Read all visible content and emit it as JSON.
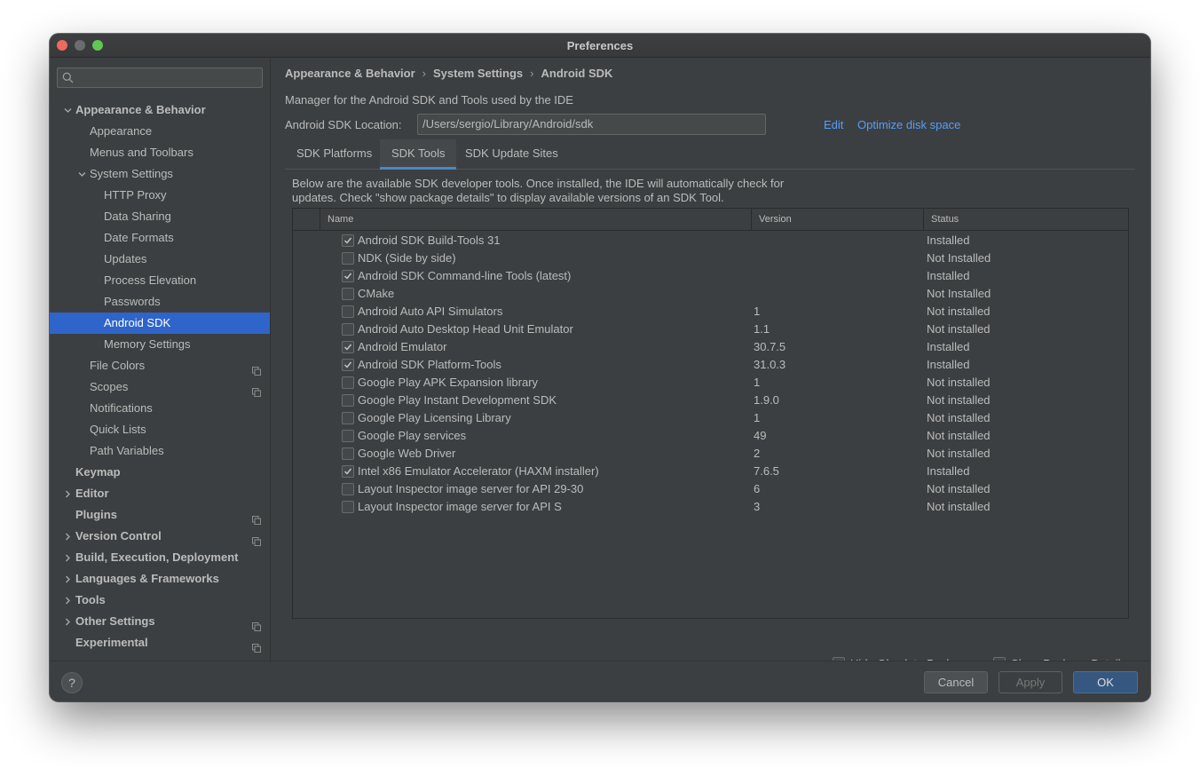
{
  "window": {
    "title": "Preferences"
  },
  "sidebar": {
    "search_placeholder": "",
    "items": [
      {
        "label": "Appearance & Behavior",
        "level": 0,
        "bold": true,
        "arrow": "down",
        "project": false,
        "selected": false
      },
      {
        "label": "Appearance",
        "level": 1,
        "bold": false,
        "arrow": "",
        "project": false,
        "selected": false
      },
      {
        "label": "Menus and Toolbars",
        "level": 1,
        "bold": false,
        "arrow": "",
        "project": false,
        "selected": false
      },
      {
        "label": "System Settings",
        "level": 1,
        "bold": false,
        "arrow": "down",
        "project": false,
        "selected": false
      },
      {
        "label": "HTTP Proxy",
        "level": 2,
        "bold": false,
        "arrow": "",
        "project": false,
        "selected": false
      },
      {
        "label": "Data Sharing",
        "level": 2,
        "bold": false,
        "arrow": "",
        "project": false,
        "selected": false
      },
      {
        "label": "Date Formats",
        "level": 2,
        "bold": false,
        "arrow": "",
        "project": false,
        "selected": false
      },
      {
        "label": "Updates",
        "level": 2,
        "bold": false,
        "arrow": "",
        "project": false,
        "selected": false
      },
      {
        "label": "Process Elevation",
        "level": 2,
        "bold": false,
        "arrow": "",
        "project": false,
        "selected": false
      },
      {
        "label": "Passwords",
        "level": 2,
        "bold": false,
        "arrow": "",
        "project": false,
        "selected": false
      },
      {
        "label": "Android SDK",
        "level": 2,
        "bold": false,
        "arrow": "",
        "project": false,
        "selected": true
      },
      {
        "label": "Memory Settings",
        "level": 2,
        "bold": false,
        "arrow": "",
        "project": false,
        "selected": false
      },
      {
        "label": "File Colors",
        "level": 1,
        "bold": false,
        "arrow": "",
        "project": true,
        "selected": false
      },
      {
        "label": "Scopes",
        "level": 1,
        "bold": false,
        "arrow": "",
        "project": true,
        "selected": false
      },
      {
        "label": "Notifications",
        "level": 1,
        "bold": false,
        "arrow": "",
        "project": false,
        "selected": false
      },
      {
        "label": "Quick Lists",
        "level": 1,
        "bold": false,
        "arrow": "",
        "project": false,
        "selected": false
      },
      {
        "label": "Path Variables",
        "level": 1,
        "bold": false,
        "arrow": "",
        "project": false,
        "selected": false
      },
      {
        "label": "Keymap",
        "level": 0,
        "bold": true,
        "arrow": "",
        "project": false,
        "selected": false
      },
      {
        "label": "Editor",
        "level": 0,
        "bold": true,
        "arrow": "right",
        "project": false,
        "selected": false
      },
      {
        "label": "Plugins",
        "level": 0,
        "bold": true,
        "arrow": "",
        "project": true,
        "selected": false
      },
      {
        "label": "Version Control",
        "level": 0,
        "bold": true,
        "arrow": "right",
        "project": true,
        "selected": false
      },
      {
        "label": "Build, Execution, Deployment",
        "level": 0,
        "bold": true,
        "arrow": "right",
        "project": false,
        "selected": false
      },
      {
        "label": "Languages & Frameworks",
        "level": 0,
        "bold": true,
        "arrow": "right",
        "project": false,
        "selected": false
      },
      {
        "label": "Tools",
        "level": 0,
        "bold": true,
        "arrow": "right",
        "project": false,
        "selected": false
      },
      {
        "label": "Other Settings",
        "level": 0,
        "bold": true,
        "arrow": "right",
        "project": true,
        "selected": false
      },
      {
        "label": "Experimental",
        "level": 0,
        "bold": true,
        "arrow": "",
        "project": true,
        "selected": false
      }
    ]
  },
  "breadcrumb": {
    "part1": "Appearance & Behavior",
    "part2": "System Settings",
    "part3": "Android SDK",
    "separator": "›"
  },
  "main": {
    "description": "Manager for the Android SDK and Tools used by the IDE",
    "location_label": "Android SDK Location:",
    "location_value": "/Users/sergio/Library/Android/sdk",
    "edit_link": "Edit",
    "optimize_link": "Optimize disk space",
    "tabs": [
      {
        "label": "SDK Platforms",
        "active": false
      },
      {
        "label": "SDK Tools",
        "active": true
      },
      {
        "label": "SDK Update Sites",
        "active": false
      }
    ],
    "tools_description_line1": "Below are the available SDK developer tools. Once installed, the IDE will automatically check for",
    "tools_description_line2": "updates. Check \"show package details\" to display available versions of an SDK Tool.",
    "table": {
      "columns": {
        "name": "Name",
        "version": "Version",
        "status": "Status"
      },
      "rows": [
        {
          "name": "Android SDK Build-Tools 31",
          "version": "",
          "status": "Installed",
          "checked": true
        },
        {
          "name": "NDK (Side by side)",
          "version": "",
          "status": "Not Installed",
          "checked": false
        },
        {
          "name": "Android SDK Command-line Tools (latest)",
          "version": "",
          "status": "Installed",
          "checked": true
        },
        {
          "name": "CMake",
          "version": "",
          "status": "Not Installed",
          "checked": false
        },
        {
          "name": "Android Auto API Simulators",
          "version": "1",
          "status": "Not installed",
          "checked": false
        },
        {
          "name": "Android Auto Desktop Head Unit Emulator",
          "version": "1.1",
          "status": "Not installed",
          "checked": false
        },
        {
          "name": "Android Emulator",
          "version": "30.7.5",
          "status": "Installed",
          "checked": true
        },
        {
          "name": "Android SDK Platform-Tools",
          "version": "31.0.3",
          "status": "Installed",
          "checked": true
        },
        {
          "name": "Google Play APK Expansion library",
          "version": "1",
          "status": "Not installed",
          "checked": false
        },
        {
          "name": "Google Play Instant Development SDK",
          "version": "1.9.0",
          "status": "Not installed",
          "checked": false
        },
        {
          "name": "Google Play Licensing Library",
          "version": "1",
          "status": "Not installed",
          "checked": false
        },
        {
          "name": "Google Play services",
          "version": "49",
          "status": "Not installed",
          "checked": false
        },
        {
          "name": "Google Web Driver",
          "version": "2",
          "status": "Not installed",
          "checked": false
        },
        {
          "name": "Intel x86 Emulator Accelerator (HAXM installer)",
          "version": "7.6.5",
          "status": "Installed",
          "checked": true
        },
        {
          "name": "Layout Inspector image server for API 29-30",
          "version": "6",
          "status": "Not installed",
          "checked": false
        },
        {
          "name": "Layout Inspector image server for API S",
          "version": "3",
          "status": "Not installed",
          "checked": false
        }
      ]
    },
    "hide_obsolete_label": "Hide Obsolete Packages",
    "hide_obsolete_checked": true,
    "show_details_label": "Show Package Details",
    "show_details_checked": false
  },
  "footer": {
    "help_label": "?",
    "cancel_label": "Cancel",
    "apply_label": "Apply",
    "ok_label": "OK"
  },
  "colors": {
    "background": "#3c3f41",
    "selection": "#2f65ca",
    "link": "#589df6",
    "ok_button": "#365880",
    "tab_underline": "#4a88c7"
  },
  "icons": {
    "search": "search-icon",
    "tree_arrow": "chevron-icon",
    "project_scope": "project-settings-icon",
    "checkmark": "checkmark-icon"
  }
}
